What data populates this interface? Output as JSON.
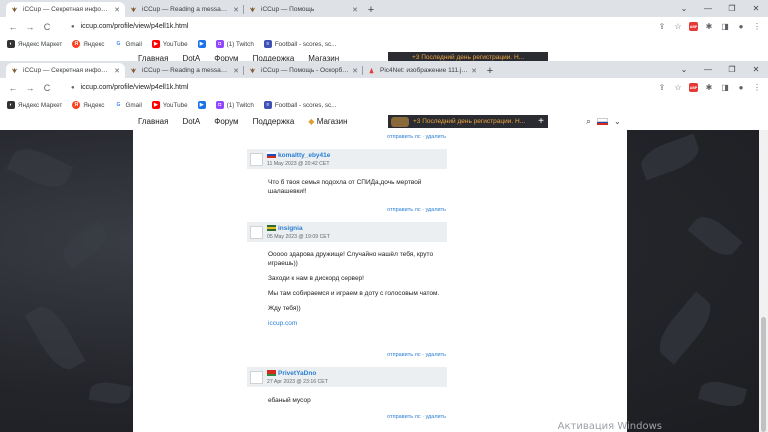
{
  "window1": {
    "tabs": [
      {
        "label": "iCCup — Секретная информация",
        "active": true
      },
      {
        "label": "iCCup — Reading a message fro",
        "active": false
      },
      {
        "label": "iCCup — Помощь",
        "active": false
      }
    ],
    "url": "iccup.com/profile/view/p4ell1k.html"
  },
  "window2": {
    "tabs": [
      {
        "label": "iCCup — Секретная информация",
        "active": true
      },
      {
        "label": "iCCup — Reading a message fro",
        "active": false
      },
      {
        "label": "iCCup — Помощь - Оскорблени",
        "active": false
      },
      {
        "label": "Pic4Net: изображение 111.jpg",
        "active": false
      }
    ],
    "url": "iccup.com/profile/view/p4ell1k.html"
  },
  "window_controls": {
    "minimize": "—",
    "restore": "❐",
    "close": "✕",
    "chevron": "⌄"
  },
  "toolbar_icons": {
    "back": "←",
    "forward": "→",
    "reload": "C",
    "lock": "🔒",
    "share": "⇪",
    "star": "☆",
    "abp": "ABP",
    "puzzle": "✱",
    "sidepanel": "◨",
    "profile": "●",
    "menu": "⋮"
  },
  "bookmarks": [
    {
      "label": "Яндекс Маркет",
      "icon": "market-icon",
      "color": "#444"
    },
    {
      "label": "Яндекс",
      "icon": "yandex-icon",
      "color": "#fc3f1d"
    },
    {
      "label": "Gmail",
      "icon": "google-icon",
      "color": "#4285f4"
    },
    {
      "label": "YouTube",
      "icon": "youtube-icon",
      "color": "#ff0000"
    },
    {
      "label": "",
      "icon": "tabs-icon",
      "color": "#1a73e8"
    },
    {
      "label": "(1) Twitch",
      "icon": "twitch-icon",
      "color": "#9146ff"
    },
    {
      "label": "Football - scores, sc...",
      "icon": "football-icon",
      "color": "#3f51b5"
    }
  ],
  "site_nav": {
    "items": [
      "Главная",
      "DotA",
      "Форум",
      "Поддержка",
      "Магазин"
    ],
    "promo": "+3 Последний день регистрации. Н...",
    "promo_plus": "+",
    "search_icon": "⌕",
    "chevron": "⌄"
  },
  "actions": {
    "send_pm": "отправить лс",
    "separator": "·",
    "delete": "удалить"
  },
  "comments": [
    {
      "author": "komaltty_eby41e",
      "date": "11 May 2023 @ 20:42 CET",
      "paragraphs": [
        "Что б твоя семья подохла от СПИДа,дочь мертвой шалашевки!!"
      ]
    },
    {
      "author": "insignia",
      "date": "05 May 2023 @ 19:09 CET",
      "paragraphs": [
        "Ооооо здарова дружище! Случайно нашёл тебя, круто играешь))",
        "Заходи к нам в дискорд сервер!",
        "Мы там собираемся и играем в доту с голосовым чатом.",
        "Жду тебя))",
        "iccup.com"
      ]
    },
    {
      "author": "PrivetYaDno",
      "date": "27 Apr 2023 @ 23:16 CET",
      "paragraphs": [
        "ебаный мусор"
      ]
    }
  ],
  "watermark": "Активация Windows",
  "colors": {
    "accent": "#2a7fd4",
    "promo_bg": "#2a2c31",
    "promo_text": "#f0a641"
  }
}
